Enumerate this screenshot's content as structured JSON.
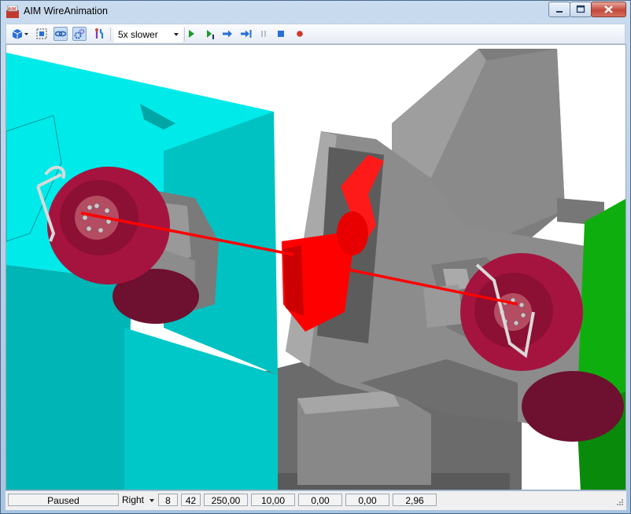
{
  "window": {
    "title": "AIM WireAnimation",
    "icon_text": "AIM"
  },
  "toolbar": {
    "speed": "5x slower",
    "buttons": [
      "view-cube-icon",
      "fit-view-icon",
      "link-icon",
      "gear-icon",
      "tools-icon",
      "play-icon",
      "step-icon",
      "forward-icon",
      "skip-end-icon",
      "pause-icon",
      "stop-icon",
      "record-icon"
    ]
  },
  "colors": {
    "wire": "#ff0000",
    "reel": "#a5143f",
    "frame_gray": "#7c7c7c",
    "cyan_block": "#00e8e8",
    "teal_block": "#00b7b7",
    "green_block": "#12a212",
    "olive_floor": "#b8b864"
  },
  "status": {
    "state": "Paused",
    "view": "Right",
    "field1": "8",
    "field2": "42",
    "field3": "250,00",
    "field4": "10,00",
    "field5": "0,00",
    "field6": "0,00",
    "field7": "2,96"
  }
}
